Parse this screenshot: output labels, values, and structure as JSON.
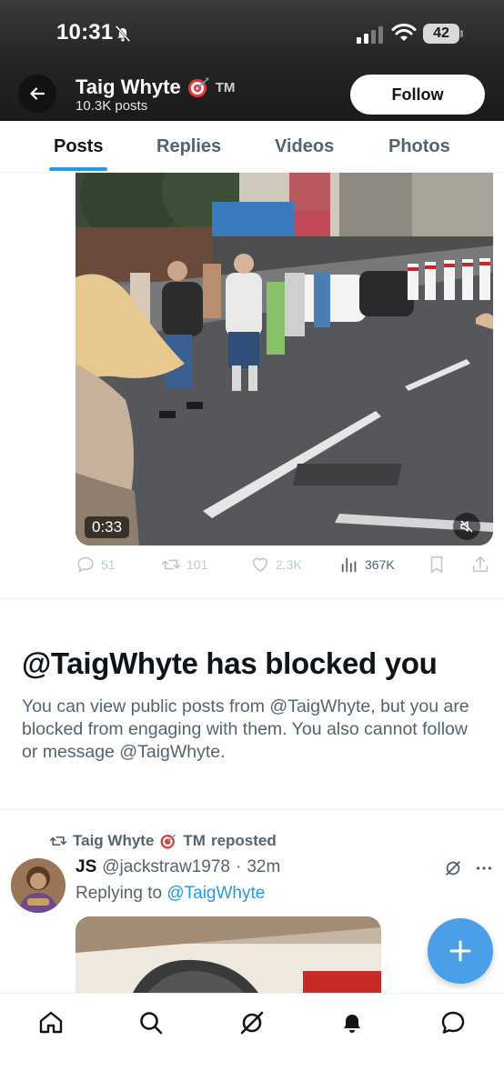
{
  "status_bar": {
    "time": "10:31",
    "battery": "42"
  },
  "header": {
    "name": "Taig Whyte",
    "trademark": "TM",
    "post_count": "10.3K posts",
    "follow_label": "Follow"
  },
  "tabs": [
    {
      "label": "Posts",
      "active": true
    },
    {
      "label": "Replies",
      "active": false
    },
    {
      "label": "Videos",
      "active": false
    },
    {
      "label": "Photos",
      "active": false
    }
  ],
  "video_post": {
    "duration": "0:33",
    "stats": {
      "replies": "51",
      "reposts": "101",
      "likes": "2.3K",
      "views": "367K"
    }
  },
  "blocked": {
    "title": "@TaigWhyte has blocked you",
    "message": "You can view public posts from @TaigWhyte, but you are blocked from engaging with them. You also cannot follow or message @TaigWhyte."
  },
  "repost": {
    "reposter_name": "Taig Whyte",
    "reposter_tm": "TM",
    "reposted_label": "reposted",
    "author_name": "JS",
    "author_handle": "@jackstraw1978",
    "separator": "·",
    "time": "32m",
    "replying_prefix": "Replying to",
    "replying_to": "@TaigWhyte"
  },
  "colors": {
    "accent": "#1d9bf0",
    "fab": "#4a9fe8",
    "text_secondary": "#536471"
  },
  "icons": [
    "back-arrow-icon",
    "dart-target-icon",
    "mute-icon",
    "reply-icon",
    "repost-icon",
    "like-icon",
    "views-icon",
    "bookmark-icon",
    "share-icon",
    "grok-icon",
    "more-icon",
    "compose-plus-icon",
    "home-icon",
    "search-icon",
    "notifications-icon",
    "messages-icon"
  ]
}
